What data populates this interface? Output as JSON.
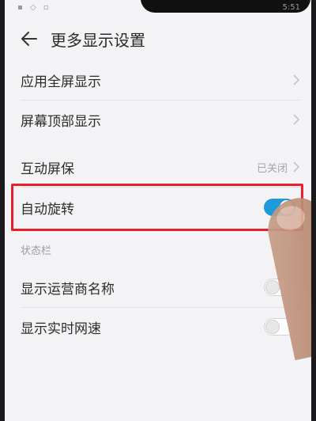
{
  "status_bar": {
    "left_icons": "▪ ◇ ▫",
    "right_text": "5:51"
  },
  "header": {
    "title": "更多显示设置"
  },
  "rows": {
    "fullscreen": {
      "label": "应用全屏显示"
    },
    "top_display": {
      "label": "屏幕顶部显示"
    },
    "screensaver": {
      "label": "互动屏保",
      "value": "已关闭"
    },
    "auto_rotate": {
      "label": "自动旋转",
      "state": "on"
    }
  },
  "status_section": {
    "title": "状态栏",
    "carrier_name": {
      "label": "显示运营商名称",
      "state": "off"
    },
    "network_speed": {
      "label": "显示实时网速",
      "state": "off"
    }
  },
  "colors": {
    "accent": "#1f9ad8",
    "highlight": "#e8202a",
    "background": "#f3f3f5"
  }
}
